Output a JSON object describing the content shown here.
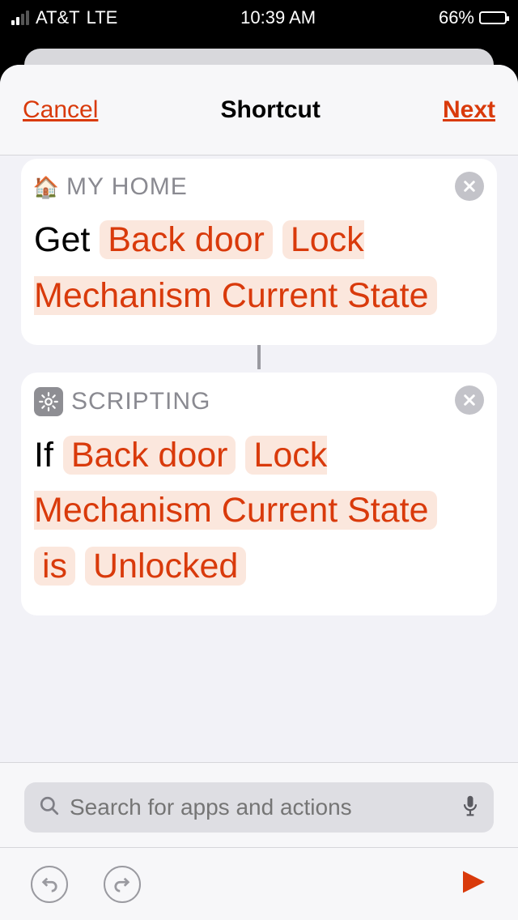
{
  "status": {
    "carrier": "AT&T",
    "network": "LTE",
    "time": "10:39 AM",
    "battery": "66%"
  },
  "nav": {
    "cancel": "Cancel",
    "title": "Shortcut",
    "next": "Next"
  },
  "cards": [
    {
      "category": "MY HOME",
      "prefix": "Get",
      "tokens": [
        "Back door",
        "Lock Mechanism Current State"
      ]
    },
    {
      "category": "SCRIPTING",
      "prefix": "If",
      "tokens": [
        "Back door",
        "Lock Mechanism Current State",
        "is",
        "Unlocked"
      ]
    }
  ],
  "search": {
    "placeholder": "Search for apps and actions"
  }
}
